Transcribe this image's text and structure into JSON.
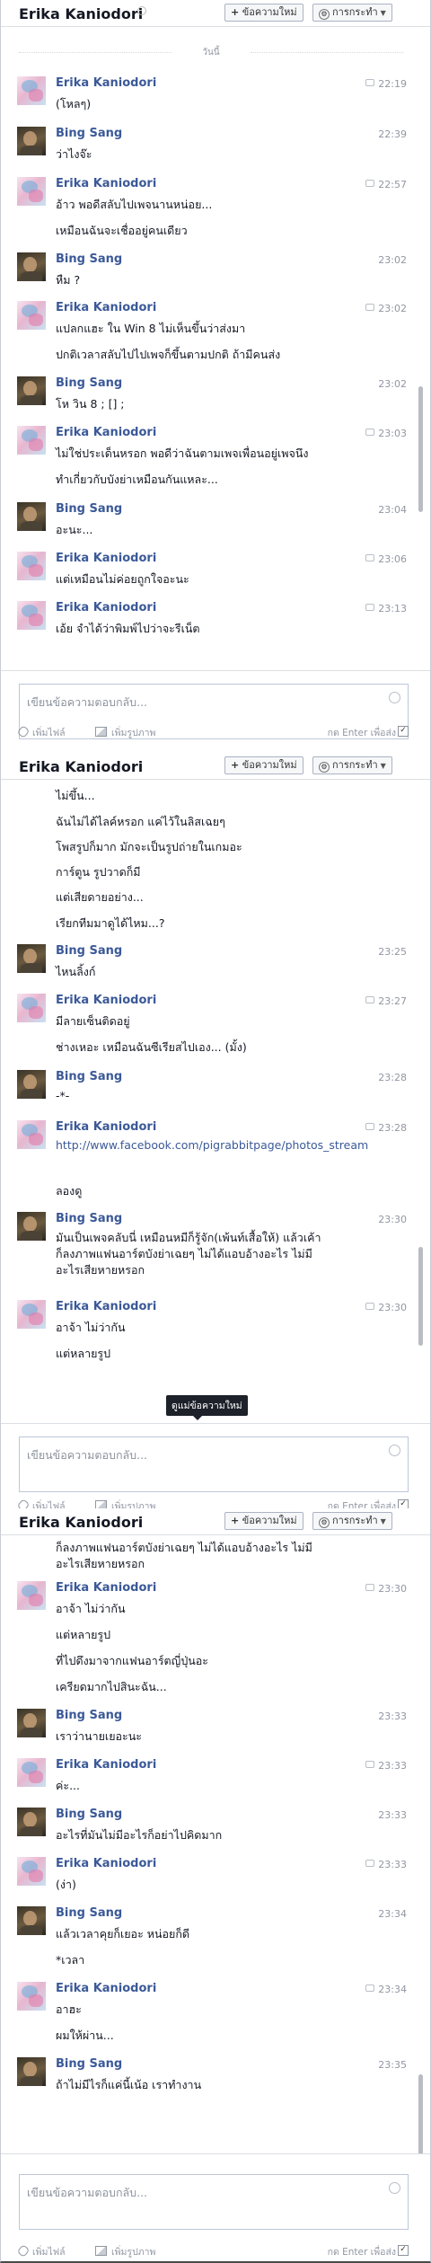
{
  "chat_title": "Erika Kaniodori",
  "header": {
    "new_message": "ข้อความใหม่",
    "actions": "การกระทำ",
    "new_message_plus": "+",
    "actions_icon": "gear-icon"
  },
  "composer": {
    "placeholder": "เขียนข้อความตอบกลับ...",
    "attach_file": "เพิ่มไฟล์",
    "add_photo": "เพิ่มรูปภาพ",
    "press_enter": "กด Enter เพื่อส่ง",
    "check": "✓"
  },
  "panel1": {
    "today": "วันนี้",
    "messages": [
      {
        "sender": "Erika Kaniodori",
        "time": "22:19",
        "lines": [
          "(โหลๆ)"
        ]
      },
      {
        "sender": "Bing Sang",
        "time": "22:39",
        "lines": [
          "ว่าไงจ๊ะ"
        ]
      },
      {
        "sender": "Erika Kaniodori",
        "time": "22:57",
        "lines": [
          "อ้าว พอดีสลับไปเพจนานหน่อย...",
          "เหมือนฉันจะเชื่ออยู่คนเดียว"
        ]
      },
      {
        "sender": "Bing Sang",
        "time": "23:02",
        "lines": [
          "หืม ?"
        ]
      },
      {
        "sender": "Erika Kaniodori",
        "time": "23:02",
        "lines": [
          "แปลกแฮะ ใน Win 8 ไม่เห็นขึ้นว่าส่งมา",
          "ปกติเวลาสลับไปไปเพจก็ขึ้นตามปกติ ถ้ามีคนส่ง"
        ]
      },
      {
        "sender": "Bing Sang",
        "time": "23:02",
        "lines": [
          "โห วิน 8 ; [] ;"
        ]
      },
      {
        "sender": "Erika Kaniodori",
        "time": "23:03",
        "lines": [
          "ไม่ใช่ประเด็นหรอก พอดีว่าฉันตามเพจเพื่อนอยู่เพจนึง",
          "ทำเกี่ยวกับบังย่าเหมือนกันแหละ..."
        ]
      },
      {
        "sender": "Bing Sang",
        "time": "23:04",
        "lines": [
          "อะนะ..."
        ]
      },
      {
        "sender": "Erika Kaniodori",
        "time": "23:06",
        "lines": [
          "แต่เหมือนไม่ค่อยถูกใจอะนะ"
        ]
      },
      {
        "sender": "Erika Kaniodori",
        "time": "23:13",
        "lines": [
          "เอ้ย จำได้ว่าพิมพ์ไปว่าจะรีเน็ต"
        ]
      }
    ]
  },
  "panel2": {
    "messages": [
      {
        "sender": "",
        "time": "",
        "lines": [
          "ไม่ขึ้น...",
          "ฉันไม่ได้ไลค์หรอก แค่ไว้ในลิสเฉยๆ",
          "โพสรูปก็มาก มักจะเป็นรูปถ่ายในเกมอะ",
          "การ์ตูน รูปวาดก็มี",
          "แต่เสียดายอย่าง...",
          "เรียกทีมมาดูได้ไหม...?"
        ]
      },
      {
        "sender": "Bing Sang",
        "time": "23:25",
        "lines": [
          "ไหนลิ้งก์"
        ]
      },
      {
        "sender": "Erika Kaniodori",
        "time": "23:27",
        "lines": [
          "มีลายเซ็นติดอยู่",
          "ช่างเหอะ เหมือนฉันซีเรียสไปเอง... (มั้ง)"
        ]
      },
      {
        "sender": "Bing Sang",
        "time": "23:28",
        "lines": [
          "-*-"
        ]
      },
      {
        "sender": "Erika Kaniodori",
        "time": "23:28",
        "lines": [
          "http://www.facebook.com/pigrabbitpage/photos_stream",
          "ลองดู"
        ]
      },
      {
        "sender": "Bing Sang",
        "time": "23:30",
        "lines": [
          "มันเป็นเพจคลับนี่ เหมือนหมีก็รู้จัก(เพ้นท์เสื้อให้) แล้วเค้า",
          "ก็ลงภาพแฟนอาร์ตบังย่าเฉยๆ ไม่ได้แอบอ้างอะไร ไม่มี",
          "อะไรเสียหายหรอก"
        ]
      },
      {
        "sender": "Erika Kaniodori",
        "time": "23:30",
        "lines": [
          "อาจ้า ไม่ว่ากัน",
          "แต่หลายรูป"
        ]
      }
    ],
    "tooltip": "ดูแม่ข้อความใหม่"
  },
  "panel3": {
    "messages": [
      {
        "sender": "",
        "time": "",
        "lines": [
          "ก็ลงภาพแฟนอาร์ตบังย่าเฉยๆ ไม่ได้แอบอ้างอะไร ไม่มี",
          "อะไรเสียหายหรอก"
        ]
      },
      {
        "sender": "Erika Kaniodori",
        "time": "23:30",
        "lines": [
          "อาจ้า ไม่ว่ากัน",
          "แต่หลายรูป",
          "ที่ไปดึงมาจากแฟนอาร์ตญี่ปุ่นอะ",
          "เครียดมากไปสินะฉัน..."
        ]
      },
      {
        "sender": "Bing Sang",
        "time": "23:33",
        "lines": [
          "เราว่านายเยอะนะ"
        ]
      },
      {
        "sender": "Erika Kaniodori",
        "time": "23:33",
        "lines": [
          "ค่ะ..."
        ]
      },
      {
        "sender": "Bing Sang",
        "time": "23:33",
        "lines": [
          "อะไรที่มันไม่มีอะไรก็อย่าไปคิดมาก"
        ]
      },
      {
        "sender": "Erika Kaniodori",
        "time": "23:33",
        "lines": [
          "(ง่า)"
        ]
      },
      {
        "sender": "Bing Sang",
        "time": "23:34",
        "lines": [
          "แล้วเวลาคุยก็เยอะ หน่อยก็ดี",
          "*เวลา"
        ]
      },
      {
        "sender": "Erika Kaniodori",
        "time": "23:34",
        "lines": [
          "อาฮะ",
          "ผมให้ผ่าน..."
        ]
      },
      {
        "sender": "Bing Sang",
        "time": "23:35",
        "lines": [
          "ถ้าไม่มีไรก็แค่นี้เน้อ เราทำงาน"
        ]
      }
    ]
  }
}
